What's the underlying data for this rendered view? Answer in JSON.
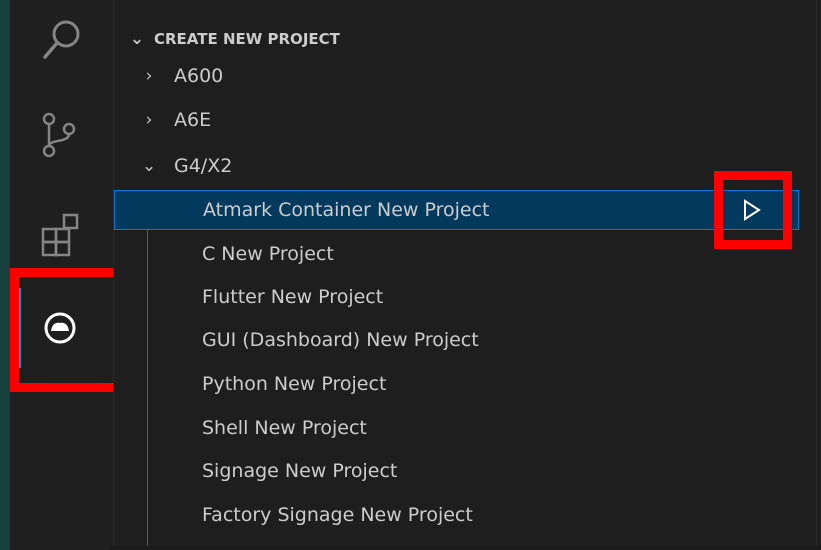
{
  "colors": {
    "selection_bg": "#04395e",
    "selection_border": "#0078d4",
    "annotation": "#ff0000",
    "active_indicator": "#1f8ad2",
    "text": "#cccccc"
  },
  "activity_bar": {
    "items": [
      {
        "icon": "search-icon"
      },
      {
        "icon": "source-control-icon"
      },
      {
        "icon": "extensions-icon"
      },
      {
        "icon": "armadillo-icon",
        "active": true
      }
    ]
  },
  "explorer": {
    "section_title": "CREATE NEW PROJECT",
    "groups": [
      {
        "label": "A600",
        "expanded": false
      },
      {
        "label": "A6E",
        "expanded": false
      },
      {
        "label": "G4/X2",
        "expanded": true
      }
    ],
    "items": [
      {
        "label": "Atmark Container New Project",
        "selected": true
      },
      {
        "label": "C New Project"
      },
      {
        "label": "Flutter New Project"
      },
      {
        "label": "GUI (Dashboard) New Project"
      },
      {
        "label": "Python New Project"
      },
      {
        "label": "Shell New Project"
      },
      {
        "label": "Signage New Project"
      },
      {
        "label": "Factory Signage New Project"
      }
    ],
    "run_action_icon": "run-icon"
  }
}
